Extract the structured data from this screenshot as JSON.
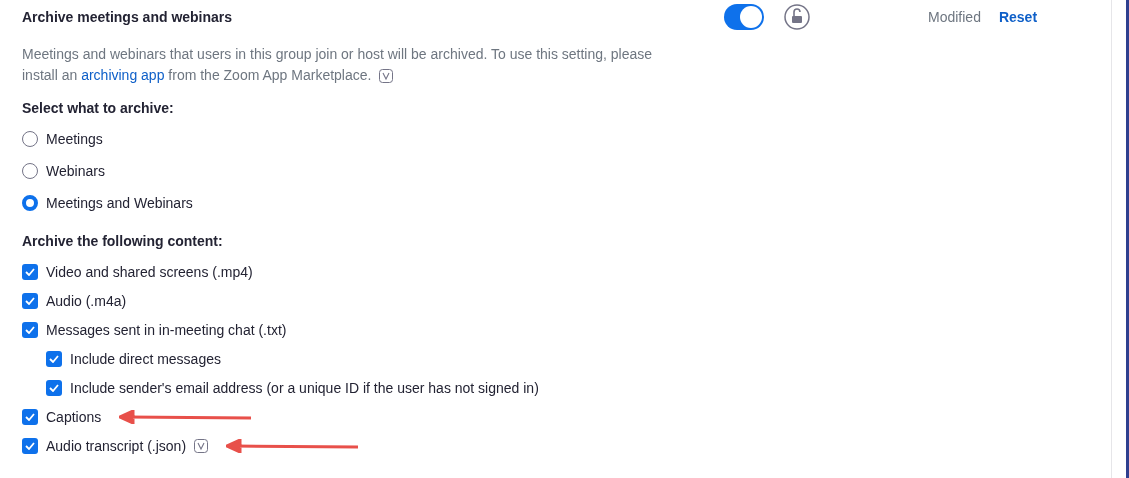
{
  "setting": {
    "title": "Archive meetings and webinars",
    "enabled": true,
    "locked": false,
    "status": "Modified",
    "reset": "Reset"
  },
  "description": {
    "before": "Meetings and webinars that users in this group join or host will be archived. To use this setting, please install an ",
    "link": "archiving app",
    "after": " from the Zoom App Marketplace."
  },
  "select_heading": "Select what to archive:",
  "options": [
    {
      "label": "Meetings",
      "selected": false
    },
    {
      "label": "Webinars",
      "selected": false
    },
    {
      "label": "Meetings and Webinars",
      "selected": true
    }
  ],
  "content_heading": "Archive the following content:",
  "content": [
    {
      "label": "Video and shared screens (.mp4)",
      "checked": true
    },
    {
      "label": "Audio (.m4a)",
      "checked": true
    },
    {
      "label": "Messages sent in in-meeting chat (.txt)",
      "checked": true,
      "children": [
        {
          "label": "Include direct messages",
          "checked": true
        },
        {
          "label": "Include sender's email address (or a unique ID if the user has not signed in)",
          "checked": true
        }
      ]
    },
    {
      "label": "Captions",
      "checked": true,
      "arrow": true
    },
    {
      "label": "Audio transcript (.json)",
      "checked": true,
      "info": true,
      "arrow": true
    }
  ]
}
